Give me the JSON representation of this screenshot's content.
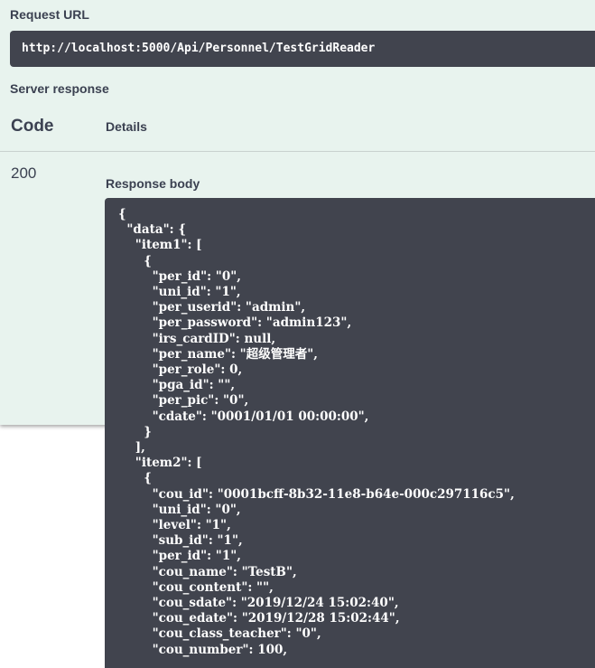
{
  "request": {
    "label": "Request URL",
    "url": "http://localhost:5000/Api/Personnel/TestGridReader"
  },
  "response": {
    "label": "Server response",
    "columns": {
      "code": "Code",
      "details": "Details"
    },
    "status_code": "200",
    "body_label": "Response body",
    "body_lines": [
      "{",
      "  \"data\": {",
      "    \"item1\": [",
      "      {",
      "        \"per_id\": \"0\",",
      "        \"uni_id\": \"1\",",
      "        \"per_userid\": \"admin\",",
      "        \"per_password\": \"admin123\",",
      "        \"irs_cardID\": null,",
      "        \"per_name\": \"超级管理者\",",
      "        \"per_role\": 0,",
      "        \"pga_id\": \"\",",
      "        \"per_pic\": \"0\",",
      "        \"cdate\": \"0001/01/01 00:00:00\",",
      "      }",
      "    ],",
      "    \"item2\": [",
      "      {",
      "        \"cou_id\": \"0001bcff-8b32-11e8-b64e-000c297116c5\",",
      "        \"uni_id\": \"0\",",
      "        \"level\": \"1\",",
      "        \"sub_id\": \"1\",",
      "        \"per_id\": \"1\",",
      "        \"cou_name\": \"TestB\",",
      "        \"cou_content\": \"\",",
      "        \"cou_sdate\": \"2019/12/24 15:02:40\",",
      "        \"cou_edate\": \"2019/12/28 15:02:44\",",
      "        \"cou_class_teacher\": \"0\",",
      "        \"cou_number\": 100,"
    ]
  },
  "colors": {
    "panel_bg": "#e8f3ee",
    "code_bg": "#41444e",
    "text": "#3b4151"
  }
}
